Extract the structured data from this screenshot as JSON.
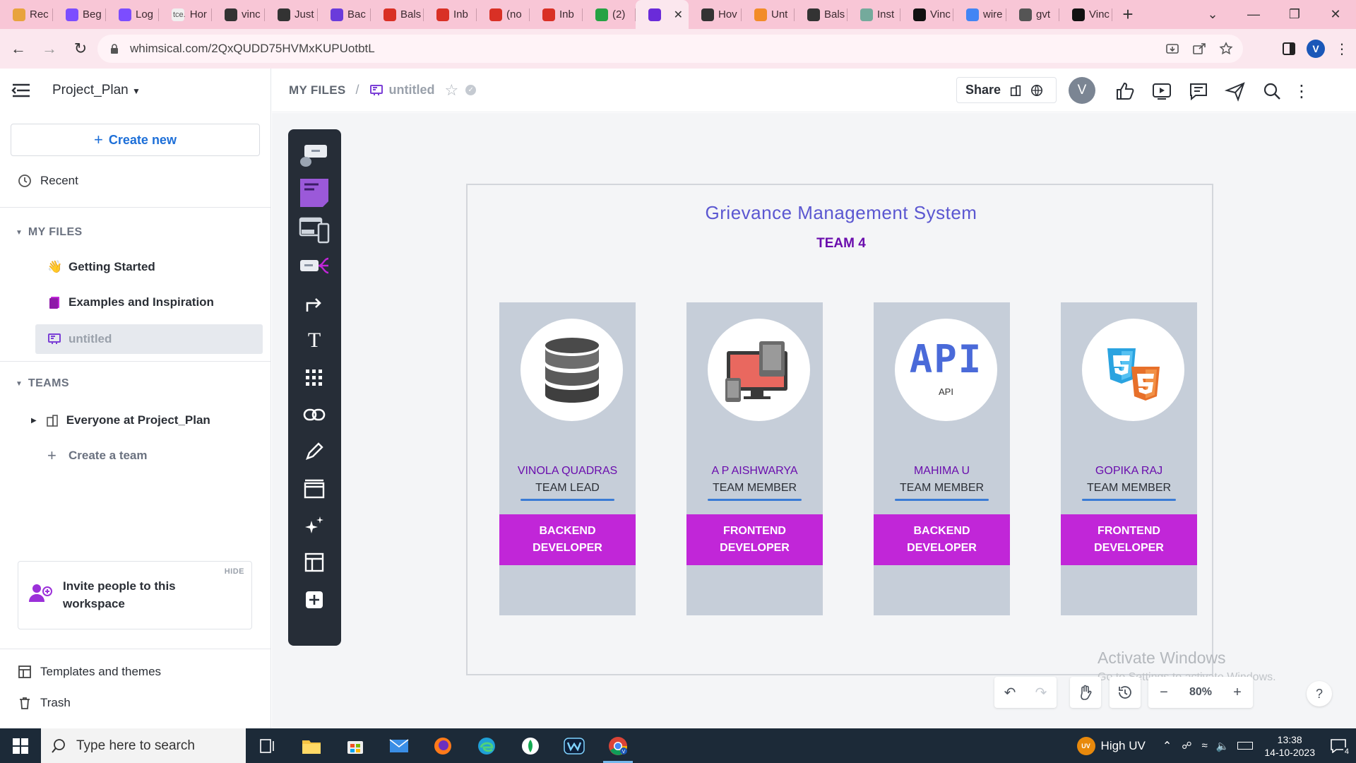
{
  "browser": {
    "tabs": [
      {
        "title": "Rec",
        "favicon_color": "#e8a33d",
        "favicon": "triangle-icon"
      },
      {
        "title": "Beg",
        "favicon_color": "#7c4dff",
        "favicon": "u-icon"
      },
      {
        "title": "Log",
        "favicon_color": "#7c4dff",
        "favicon": "u-icon"
      },
      {
        "title": "Hor",
        "favicon_color": "#f0f0f0",
        "favicon": "tce-icon",
        "prefix": "tce."
      },
      {
        "title": "vinc",
        "favicon_color": "#333333",
        "favicon": "cc-icon"
      },
      {
        "title": "Just",
        "favicon_color": "#333333",
        "favicon": "cc-icon"
      },
      {
        "title": "Bac",
        "favicon_color": "#6a3bdb",
        "favicon": "b-icon"
      },
      {
        "title": "Bals",
        "favicon_color": "#d93025",
        "favicon": "gmail-icon"
      },
      {
        "title": "Inb",
        "favicon_color": "#d93025",
        "favicon": "gmail-icon"
      },
      {
        "title": "(no",
        "favicon_color": "#d93025",
        "favicon": "gmail-icon"
      },
      {
        "title": "Inb",
        "favicon_color": "#d93025",
        "favicon": "gmail-icon"
      },
      {
        "title": "(2)",
        "favicon_color": "#25a244",
        "favicon": "whatsapp-icon"
      },
      {
        "title": "",
        "favicon_color": "#6a2bd9",
        "favicon": "whimsical-icon",
        "active": true
      },
      {
        "title": "Hov",
        "favicon_color": "#333333",
        "favicon": "th-icon"
      },
      {
        "title": "Unt",
        "favicon_color": "#f28c28",
        "favicon": "figma-icon"
      },
      {
        "title": "Bals",
        "favicon_color": "#333333",
        "favicon": "smiley-icon"
      },
      {
        "title": "Inst",
        "favicon_color": "#74aa9c",
        "favicon": "chatgpt-icon"
      },
      {
        "title": "Vinc",
        "favicon_color": "#111111",
        "favicon": "github-icon"
      },
      {
        "title": "wire",
        "favicon_color": "#4285f4",
        "favicon": "google-icon"
      },
      {
        "title": "gvt",
        "favicon_color": "#555555",
        "favicon": "globe-icon"
      },
      {
        "title": "Vinc",
        "favicon_color": "#111111",
        "favicon": "github-icon"
      }
    ],
    "url": "whimsical.com/2QxQUDD75HVMxKUPUotbtL",
    "profile_initial": "V"
  },
  "sidebar": {
    "workspace": "Project_Plan",
    "create_new": "Create new",
    "recent": "Recent",
    "my_files_header": "MY FILES",
    "files": [
      {
        "label": "Getting Started",
        "icon": "wave-icon"
      },
      {
        "label": "Examples and Inspiration",
        "icon": "book-icon"
      },
      {
        "label": "untitled",
        "icon": "board-icon",
        "active": true
      }
    ],
    "teams_header": "TEAMS",
    "team": "Everyone at Project_Plan",
    "create_team": "Create a team",
    "invite_hide": "HIDE",
    "invite_text": "Invite people to this workspace",
    "templates": "Templates and themes",
    "trash": "Trash"
  },
  "topbar": {
    "breadcrumb_root": "MY FILES",
    "separator": "/",
    "file_name": "untitled",
    "share": "Share",
    "avatar_initial": "V"
  },
  "board": {
    "title": "Grievance Management System",
    "subtitle": "TEAM 4",
    "members": [
      {
        "name": "VINOLA QUADRAS",
        "role": "TEAM LEAD",
        "badge_line1": "BACKEND",
        "badge_line2": "DEVELOPER",
        "icon": "database-icon"
      },
      {
        "name": "A P AISHWARYA",
        "role": "TEAM MEMBER",
        "badge_line1": "FRONTEND",
        "badge_line2": "DEVELOPER",
        "icon": "devices-icon"
      },
      {
        "name": "MAHIMA U",
        "role": "TEAM MEMBER",
        "badge_line1": "BACKEND",
        "badge_line2": "DEVELOPER",
        "icon": "api-icon",
        "icon_text": "API",
        "icon_caption": "API"
      },
      {
        "name": "GOPIKA RAJ",
        "role": "TEAM MEMBER",
        "badge_line1": "FRONTEND",
        "badge_line2": "DEVELOPER",
        "icon": "css-html-icon"
      }
    ]
  },
  "canvas_controls": {
    "zoom": "80%",
    "help": "?"
  },
  "watermark": {
    "line1": "Activate Windows",
    "line2": "Go to Settings to activate Windows."
  },
  "taskbar": {
    "search_placeholder": "Type here to search",
    "weather": "High UV",
    "weather_badge": "UV",
    "time": "13:38",
    "date": "14-10-2023",
    "notifications": "4"
  },
  "colors": {
    "accent_purple": "#c126d8",
    "title_blue": "#5b57d1",
    "card_bg": "#c6ced9",
    "tab_strip": "#f8c6d6",
    "link_blue": "#1d6fd8"
  }
}
